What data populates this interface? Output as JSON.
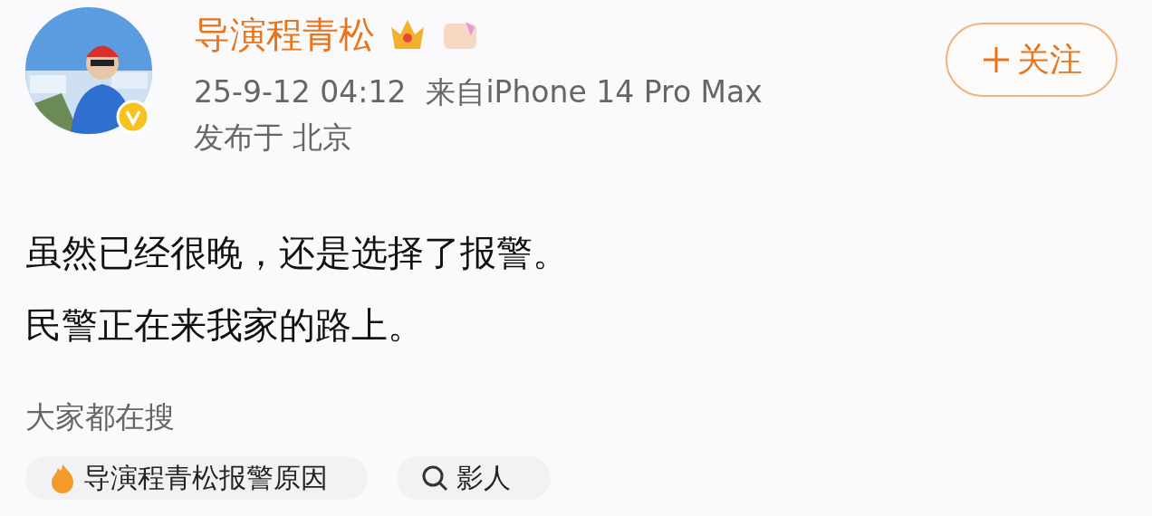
{
  "author": {
    "name": "导演程青松",
    "verified": true
  },
  "meta": {
    "time": "25-9-12 04:12",
    "source": "来自iPhone 14 Pro Max",
    "location": "发布于 北京"
  },
  "follow_button": {
    "label": "关注"
  },
  "post": {
    "lines": [
      "虽然已经很晚，还是选择了报警。",
      "民警正在来我家的路上。"
    ]
  },
  "trending": {
    "title": "大家都在搜",
    "chips": [
      {
        "kind": "hot",
        "label": "导演程青松报警原因"
      },
      {
        "kind": "search",
        "label": "影人"
      }
    ]
  }
}
